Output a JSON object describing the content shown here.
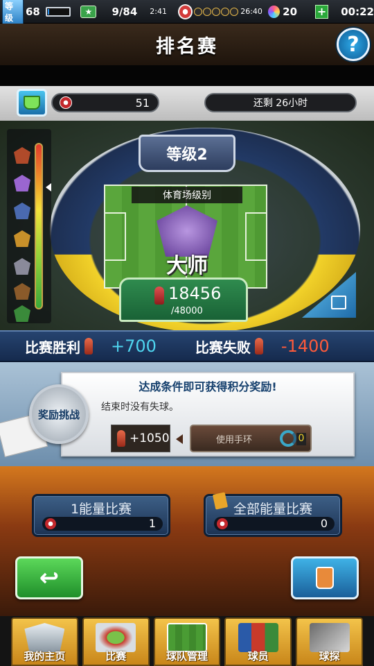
{
  "status_bar": {
    "level_tag": "等级",
    "level": "68",
    "xp_progress": 0.08,
    "tickets": "9/84",
    "ticket_timer": "2:41",
    "energy_timer": "26:40",
    "energy_dots_filled": 0,
    "energy_dots_total": 5,
    "gems": "20",
    "clock": "00:22"
  },
  "header": {
    "title": "排名赛",
    "help_label": "?"
  },
  "info_row": {
    "points": "51",
    "time_remaining": "还剩 26小时"
  },
  "stadium": {
    "grade_label": "等级2",
    "stadium_level_label": "体育场级别",
    "rank_name": "大师",
    "score": "18456",
    "score_total": "/48000"
  },
  "results": {
    "win_label": "比赛胜利",
    "win_value": "+700",
    "lose_label": "比赛失败",
    "lose_value": "-1400"
  },
  "challenge": {
    "seal_label": "奖励挑战",
    "title": "达成条件即可获得积分奖励!",
    "condition": "结束时没有失球。",
    "reward_value": "+1050",
    "use_band_label": "使用手环",
    "band_count": "0"
  },
  "energy_buttons": [
    {
      "label": "1能量比赛",
      "count": "1"
    },
    {
      "label": "全部能量比赛",
      "count": "0"
    }
  ],
  "back_icon": "↩",
  "bottom_nav": [
    {
      "label": "我的主页",
      "icon": "club-crest-icon"
    },
    {
      "label": "比赛",
      "icon": "stadium-icon"
    },
    {
      "label": "球队管理",
      "icon": "formation-icon"
    },
    {
      "label": "球员",
      "icon": "players-icon"
    },
    {
      "label": "球探",
      "icon": "scout-cards-icon"
    }
  ],
  "colors": {
    "win_value": "#4fd6f0",
    "lose_value": "#ff5a3a",
    "nav_gold": "#f3c34a",
    "back_green": "#1f8f2a",
    "primary_blue": "#1a5f9a"
  }
}
